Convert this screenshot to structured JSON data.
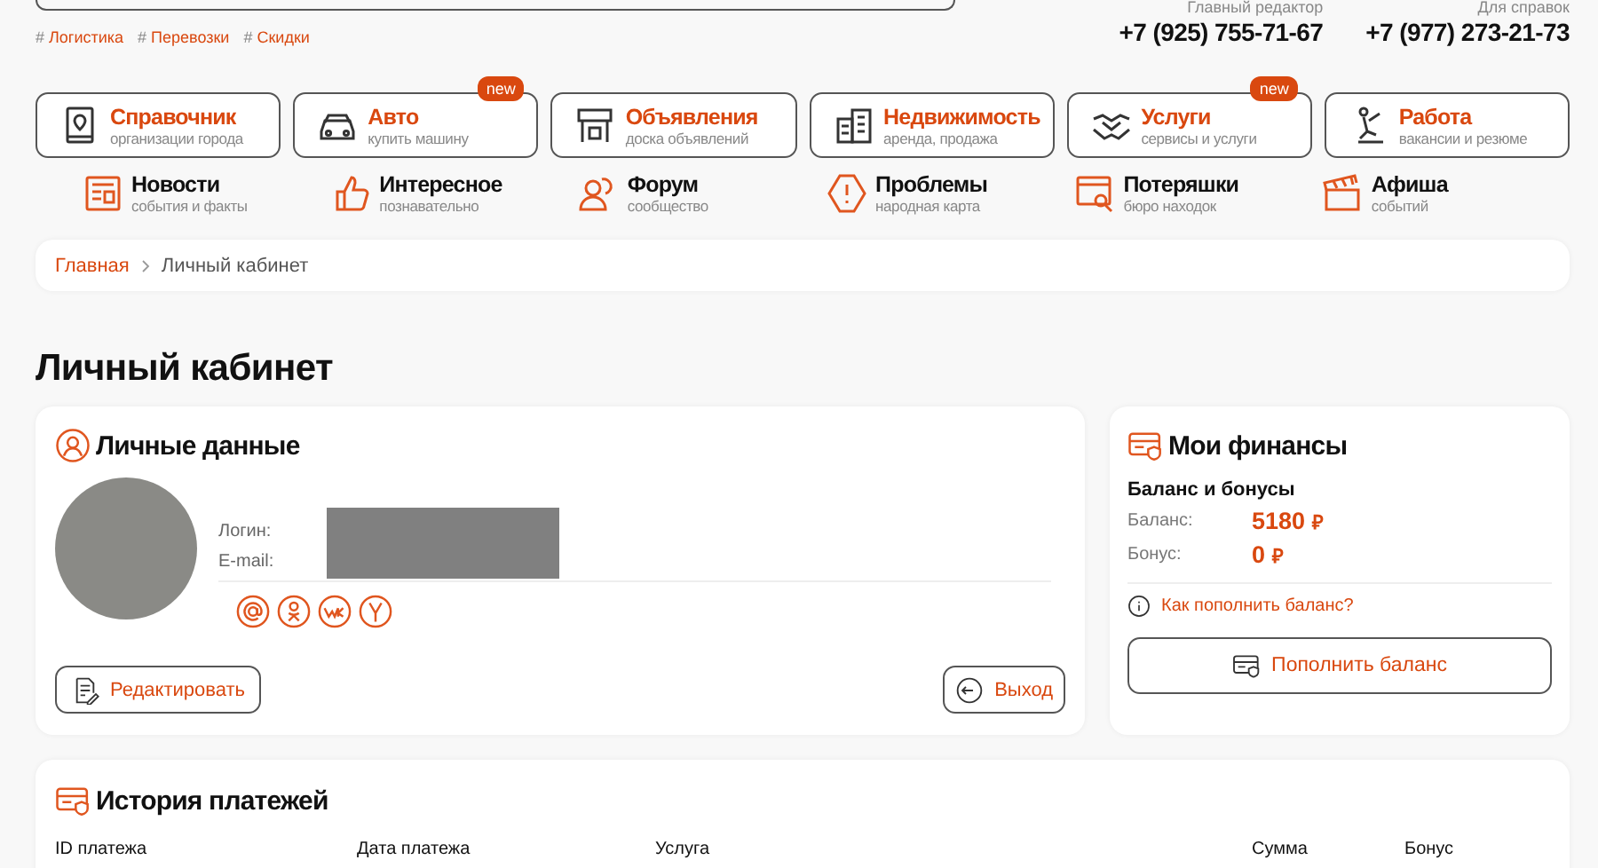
{
  "header": {
    "tags": [
      {
        "mark": "#",
        "label": "Логистика"
      },
      {
        "mark": "#",
        "label": "Перевозки"
      },
      {
        "mark": "#",
        "label": "Скидки"
      }
    ],
    "contacts": [
      {
        "label": "Главный редактор",
        "phone": "+7 (925) 755-71-67"
      },
      {
        "label": "Для справок",
        "phone": "+7 (977) 273-21-73"
      }
    ]
  },
  "main_nav": [
    {
      "title": "Справочник",
      "subtitle": "организации города"
    },
    {
      "title": "Авто",
      "subtitle": "купить машину",
      "badge": "new"
    },
    {
      "title": "Объявления",
      "subtitle": "доска объявлений"
    },
    {
      "title": "Недвижимость",
      "subtitle": "аренда, продажа"
    },
    {
      "title": "Услуги",
      "subtitle": "сервисы и услуги",
      "badge": "new"
    },
    {
      "title": "Работа",
      "subtitle": "вакансии и резюме"
    }
  ],
  "secondary_nav": [
    {
      "title": "Новости",
      "subtitle": "события и факты"
    },
    {
      "title": "Интересное",
      "subtitle": "познавательно"
    },
    {
      "title": "Форум",
      "subtitle": "сообщество"
    },
    {
      "title": "Проблемы",
      "subtitle": "народная карта"
    },
    {
      "title": "Потеряшки",
      "subtitle": "бюро находок"
    },
    {
      "title": "Афиша",
      "subtitle": "событий"
    }
  ],
  "breadcrumb": [
    "Главная",
    "Личный кабинет"
  ],
  "page_title": "Личный кабинет",
  "personal": {
    "title": "Личные данные",
    "fields": [
      {
        "label": "Логин:"
      },
      {
        "label": "E-mail:"
      }
    ],
    "socials": [
      {
        "kind": "mail"
      },
      {
        "kind": "ok"
      },
      {
        "kind": "vk"
      },
      {
        "kind": "ya"
      }
    ],
    "edit_button": "Редактировать",
    "logout_button": "Выход"
  },
  "finance": {
    "title": "Мои финансы",
    "subtitle": "Баланс и бонусы",
    "rows": [
      {
        "label": "Баланс:",
        "value": "5180",
        "currency": "₽"
      },
      {
        "label": "Бонус:",
        "value": "0",
        "currency": "₽"
      }
    ],
    "help_link": "Как пополнить баланс?",
    "topup_button": "Пополнить баланс"
  },
  "history": {
    "title": "История платежей",
    "columns": [
      "ID платежа",
      "Дата платежа",
      "Услуга",
      "Сумма",
      "Бонус"
    ]
  }
}
